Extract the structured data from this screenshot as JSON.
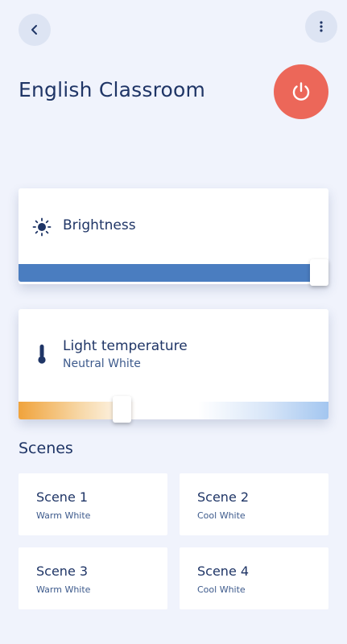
{
  "header": {
    "back_icon": "chevron-left-icon",
    "more_icon": "vertical-dots-icon",
    "title": "English Classroom",
    "power_icon": "power-icon",
    "power_color": "#ec6759"
  },
  "brightness": {
    "icon": "sun-icon",
    "label": "Brightness",
    "level": 1.0,
    "track_color": "#4a7dc0"
  },
  "temperature": {
    "icon": "thermometer-icon",
    "label": "Light temperature",
    "value": "Neutral White",
    "level": 0.33
  },
  "scenes": {
    "title": "Scenes",
    "items": [
      {
        "name": "Scene 1",
        "subtitle": "Warm White"
      },
      {
        "name": "Scene 2",
        "subtitle": "Cool White"
      },
      {
        "name": "Scene 3",
        "subtitle": "Warm White"
      },
      {
        "name": "Scene 4",
        "subtitle": "Cool White"
      }
    ]
  }
}
